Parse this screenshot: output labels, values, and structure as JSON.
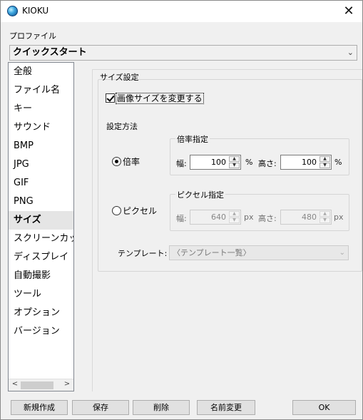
{
  "window": {
    "title": "KIOKU",
    "close_glyph": "✕"
  },
  "profile": {
    "label": "プロファイル",
    "selected": "クイックスタート"
  },
  "sidebar": {
    "items": [
      {
        "label": "全般"
      },
      {
        "label": "ファイル名"
      },
      {
        "label": "キー"
      },
      {
        "label": "サウンド"
      },
      {
        "label": "BMP"
      },
      {
        "label": "JPG"
      },
      {
        "label": "GIF"
      },
      {
        "label": "PNG"
      },
      {
        "label": "サイズ"
      },
      {
        "label": "スクリーンカッ"
      },
      {
        "label": "ディスプレイ"
      },
      {
        "label": "自動撮影"
      },
      {
        "label": "ツール"
      },
      {
        "label": "オプション"
      },
      {
        "label": "バージョン"
      }
    ],
    "active_index": 8,
    "scroll_left": "<",
    "scroll_right": ">"
  },
  "size_settings": {
    "group_title": "サイズ設定",
    "change_size_checkbox": "画像サイズを変更する",
    "method_title": "設定方法",
    "ratio": {
      "radio_label": "倍率",
      "group_title": "倍率指定",
      "width_label": "幅:",
      "width_value": "100",
      "width_unit": "%",
      "height_label": "高さ:",
      "height_value": "100",
      "height_unit": "%"
    },
    "pixel": {
      "radio_label": "ピクセル",
      "group_title": "ピクセル指定",
      "width_label": "幅:",
      "width_value": "640",
      "width_unit": "px",
      "height_label": "高さ:",
      "height_value": "480",
      "height_unit": "px"
    },
    "template_label": "テンプレート:",
    "template_value": "〈テンプレート一覧〉"
  },
  "buttons": {
    "new": "新規作成",
    "save": "保存",
    "delete": "削除",
    "rename": "名前変更",
    "ok": "OK"
  }
}
